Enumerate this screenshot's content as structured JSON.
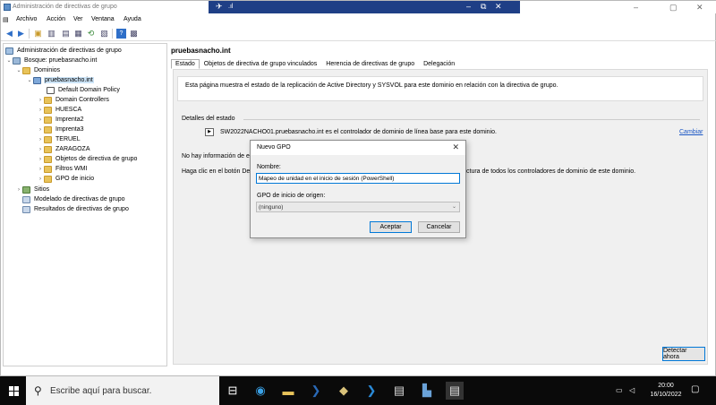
{
  "window": {
    "title": "Administración de directivas de grupo"
  },
  "menu": [
    "Archivo",
    "Acción",
    "Ver",
    "Ventana",
    "Ayuda"
  ],
  "tree": {
    "root": "Administración de directivas de grupo",
    "forest": "Bosque: pruebasnacho.int",
    "domains": "Dominios",
    "domain": "pruebasnacho.int",
    "children": [
      "Default Domain Policy",
      "Domain Controllers",
      "HUESCA",
      "Imprenta2",
      "Imprenta3",
      "TERUEL",
      "ZARAGOZA",
      "Objetos de directiva de grupo",
      "Filtros WMI",
      "GPO de inicio"
    ],
    "sites": "Sitios",
    "modeling": "Modelado de directivas de grupo",
    "results": "Resultados de directivas de grupo"
  },
  "main": {
    "title": "pruebasnacho.int",
    "tabs": [
      "Estado",
      "Objetos de directiva de grupo vinculados",
      "Herencia de directivas de grupo",
      "Delegación"
    ],
    "description": "Esta página muestra el estado de la replicación de Active Directory y SYSVOL para este dominio en relación con la directiva de grupo.",
    "details_header": "Detalles del estado",
    "status_text": "SW2022NACHO01.pruebasnacho.int es el controlador de dominio de línea base para este dominio.",
    "change_link": "Cambiar",
    "no_info": "No hay información de e",
    "help_left": "Haga clic en el botón De",
    "help_right": "ctura de todos los controladores de dominio de este dominio.",
    "detect_button": "Detectar ahora"
  },
  "dialog": {
    "title": "Nuevo GPO",
    "name_label": "Nombre:",
    "name_value": "Mapeo de unidad en el inicio de sesión (PowerShell)",
    "source_label": "GPO de inicio de origen:",
    "source_value": "(ninguno)",
    "accept": "Aceptar",
    "cancel": "Cancelar"
  },
  "taskbar": {
    "search_placeholder": "Escribe aquí para buscar.",
    "time": "20:00",
    "date": "16/10/2022"
  }
}
